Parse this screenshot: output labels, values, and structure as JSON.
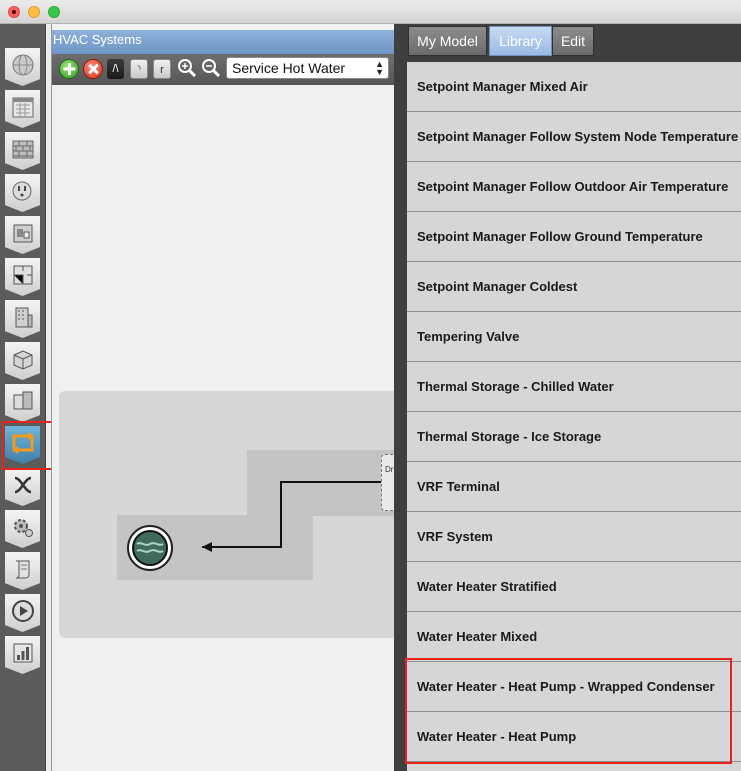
{
  "window": {
    "controls": [
      "close",
      "minimize",
      "maximize"
    ]
  },
  "nav": {
    "items": [
      {
        "name": "site",
        "icon": "globe-icon"
      },
      {
        "name": "schedules",
        "icon": "calendar-icon"
      },
      {
        "name": "constructions",
        "icon": "brick-wall-icon"
      },
      {
        "name": "loads",
        "icon": "outlet-icon"
      },
      {
        "name": "space-types",
        "icon": "space-types-icon"
      },
      {
        "name": "geometry",
        "icon": "floorplan-icon"
      },
      {
        "name": "facility",
        "icon": "building-icon"
      },
      {
        "name": "spaces",
        "icon": "box-icon"
      },
      {
        "name": "thermal-zones",
        "icon": "cubes-icon"
      },
      {
        "name": "hvac-systems",
        "icon": "hvac-loop-icon",
        "active": true
      },
      {
        "name": "variables",
        "icon": "variable-x-icon"
      },
      {
        "name": "simulation-settings",
        "icon": "gears-icon"
      },
      {
        "name": "measures",
        "icon": "scroll-icon"
      },
      {
        "name": "run-simulation",
        "icon": "play-icon"
      },
      {
        "name": "results",
        "icon": "chart-icon"
      }
    ]
  },
  "hvac": {
    "title": "HVAC Systems",
    "toolbar": {
      "b1": "/\\",
      "b2": "⸃",
      "b3": "r",
      "loop_selected": "Service Hot Water"
    },
    "demand_label": "Dr"
  },
  "library": {
    "tabs": [
      {
        "label": "My Model",
        "active": false
      },
      {
        "label": "Library",
        "active": true
      },
      {
        "label": "Edit",
        "active": false
      }
    ],
    "items": [
      "Setpoint Manager Mixed Air",
      "Setpoint Manager Follow System Node Temperature",
      "Setpoint Manager Follow Outdoor Air Temperature",
      "Setpoint Manager Follow Ground Temperature",
      "Setpoint Manager Coldest",
      "Tempering Valve",
      "Thermal Storage - Chilled Water",
      "Thermal Storage - Ice Storage",
      "VRF Terminal",
      "VRF System",
      "Water Heater Stratified",
      "Water Heater Mixed",
      "Water Heater - Heat Pump - Wrapped Condenser",
      "Water Heater - Heat Pump"
    ]
  },
  "colors": {
    "highlight": "#e8231c",
    "active_tab": "#99b9e3",
    "panel_title": "#6e95c6"
  }
}
